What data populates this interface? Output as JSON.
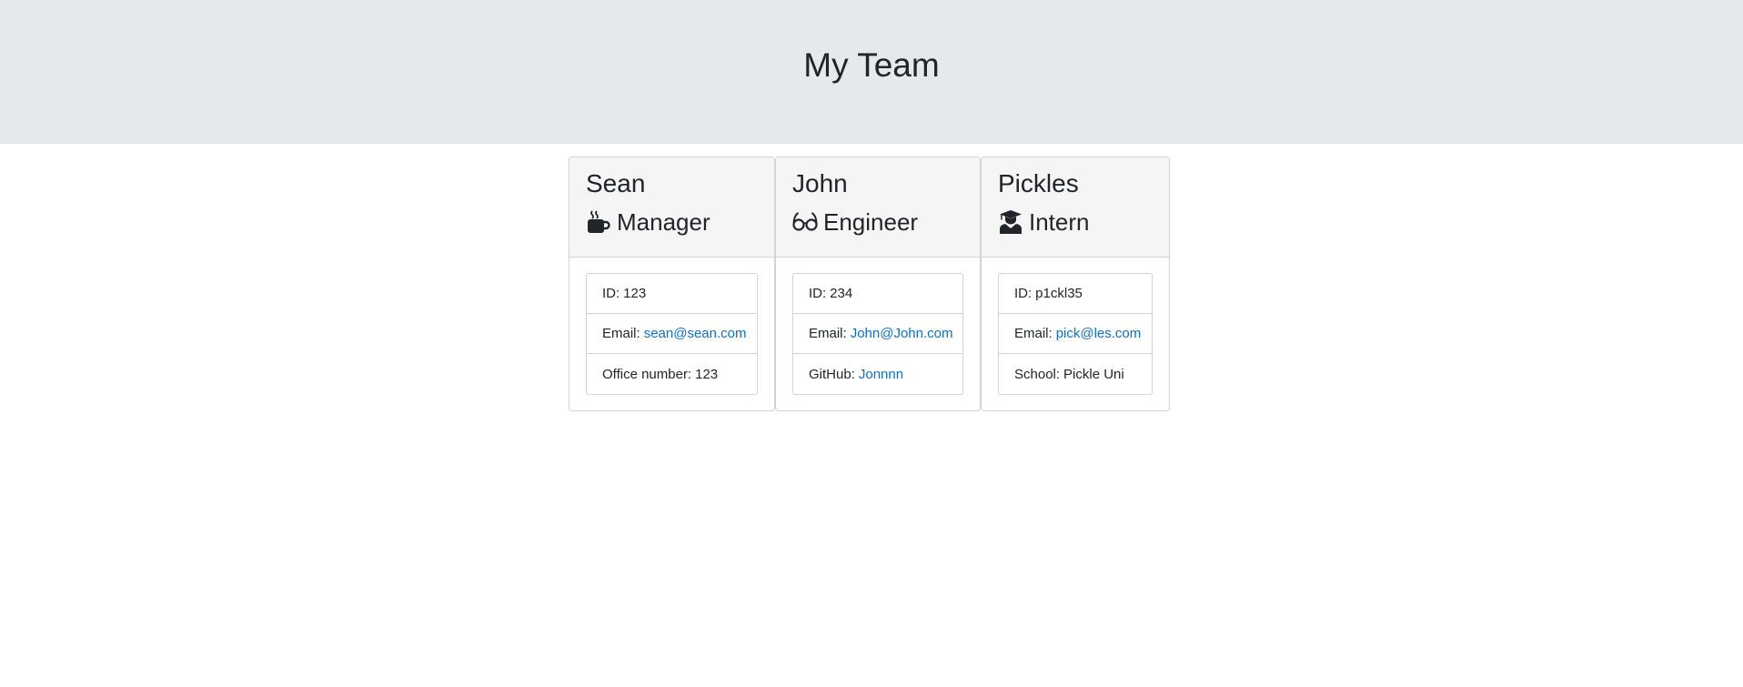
{
  "header": {
    "title": "My Team"
  },
  "employees": [
    {
      "name": "Sean",
      "role": "Manager",
      "role_icon": "coffee-mug-icon",
      "id_label": "ID:",
      "id": "123",
      "email_label": "Email:",
      "email": "sean@sean.com",
      "extra_label": "Office number:",
      "extra": "123"
    },
    {
      "name": "John",
      "role": "Engineer",
      "role_icon": "glasses-icon",
      "id_label": "ID:",
      "id": "234",
      "email_label": "Email:",
      "email": "John@John.com",
      "extra_label": "GitHub:",
      "extra": "Jonnnn"
    },
    {
      "name": "Pickles",
      "role": "Intern",
      "role_icon": "graduate-icon",
      "id_label": "ID:",
      "id": "p1ckl35",
      "email_label": "Email:",
      "email": "pick@les.com",
      "extra_label": "School:",
      "extra": "Pickle Uni"
    }
  ],
  "colors": {
    "header_bg": "#e5e9ec",
    "card_header_bg": "#f5f5f5",
    "link": "#0a6fd8",
    "text": "#212529"
  }
}
